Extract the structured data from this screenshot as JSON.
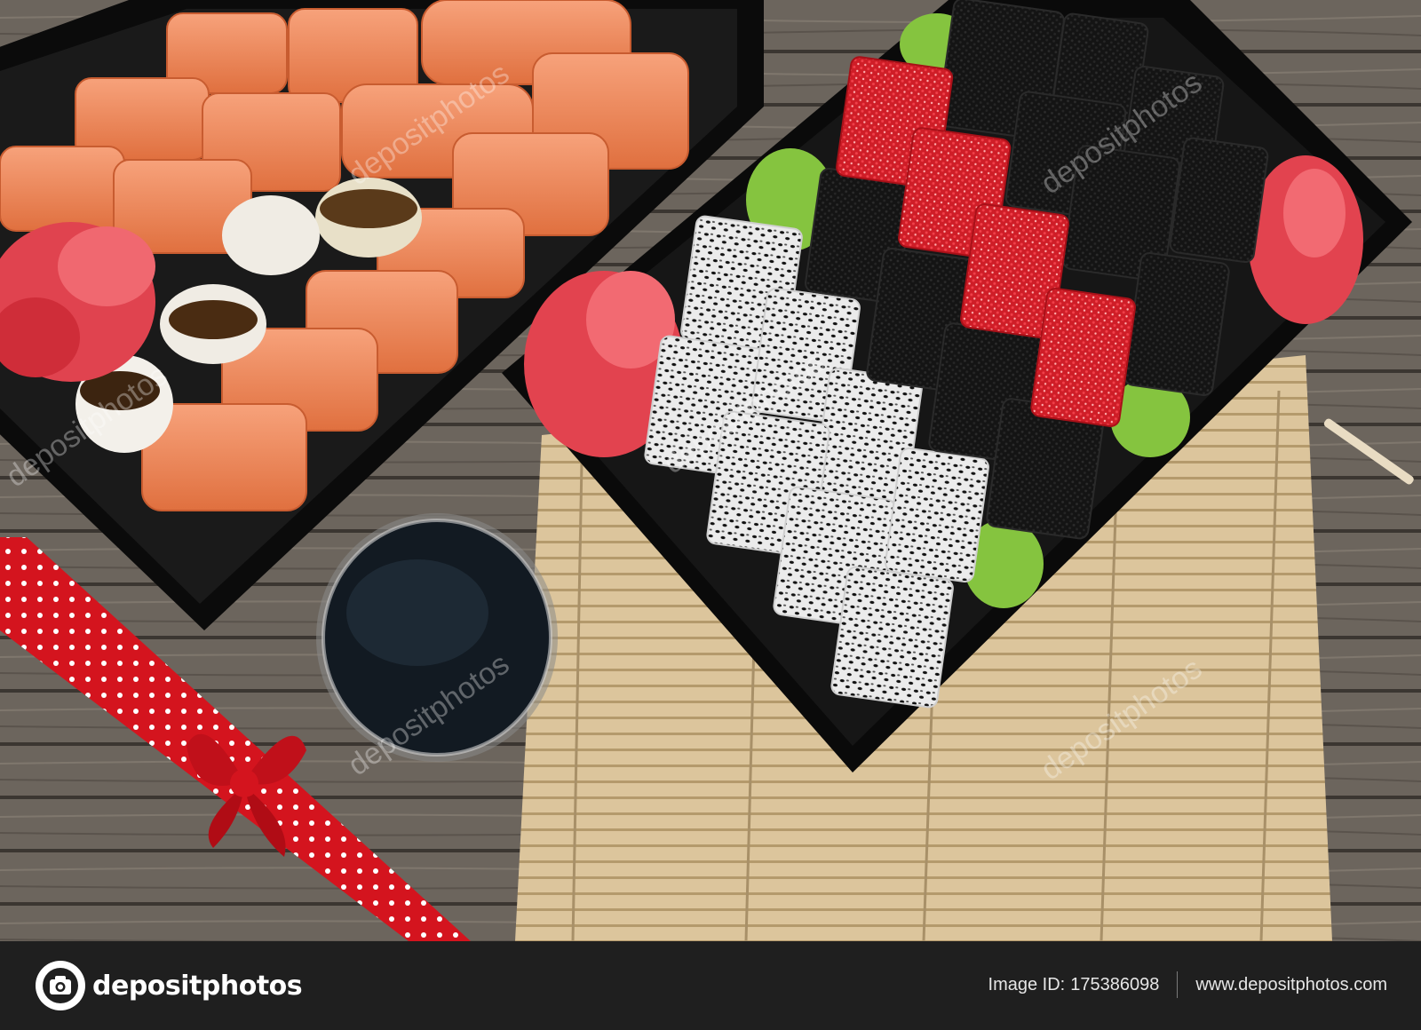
{
  "photo": {
    "subject": "sushi rolls in black trays on wooden table",
    "watermark_text": "depositphotos",
    "colors": {
      "wood": "#6b645c",
      "salmon": "#f08a5c",
      "tobiko_red": "#d8202a",
      "tobiko_black": "#151515",
      "sesame_white": "#eeeeee",
      "wasabi": "#7fbf3a",
      "ginger": "#e24a55",
      "ribbon": "#d4141e",
      "bamboo": "#d9c39a",
      "tray": "#0c0c0c"
    }
  },
  "footer": {
    "brand": "depositphotos",
    "image_id_label": "Image ID:",
    "image_id": "175386098",
    "site": "www.depositphotos.com"
  }
}
